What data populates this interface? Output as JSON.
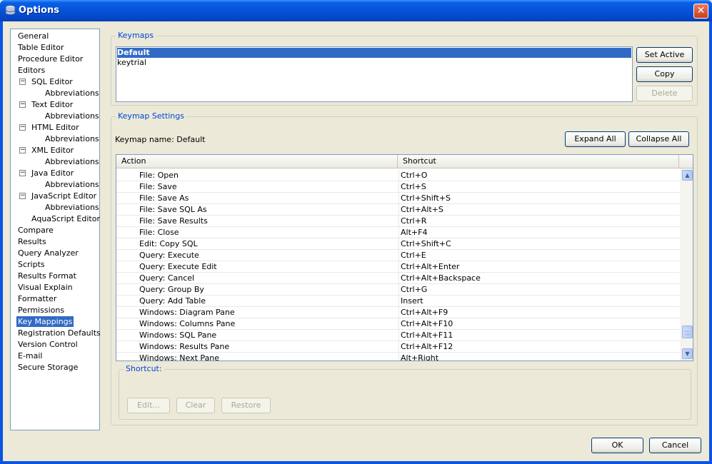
{
  "window": {
    "title": "Options",
    "close_glyph": "✕"
  },
  "nav": {
    "items": [
      {
        "label": "General",
        "indent": 0
      },
      {
        "label": "Table Editor",
        "indent": 0
      },
      {
        "label": "Procedure Editor",
        "indent": 0
      },
      {
        "label": "Editors",
        "indent": 0
      },
      {
        "label": "SQL Editor",
        "indent": 1,
        "expander": true
      },
      {
        "label": "Abbreviations",
        "indent": 2
      },
      {
        "label": "Text Editor",
        "indent": 1,
        "expander": true
      },
      {
        "label": "Abbreviations",
        "indent": 2
      },
      {
        "label": "HTML Editor",
        "indent": 1,
        "expander": true
      },
      {
        "label": "Abbreviations",
        "indent": 2
      },
      {
        "label": "XML Editor",
        "indent": 1,
        "expander": true
      },
      {
        "label": "Abbreviations",
        "indent": 2
      },
      {
        "label": "Java Editor",
        "indent": 1,
        "expander": true
      },
      {
        "label": "Abbreviations",
        "indent": 2
      },
      {
        "label": "JavaScript Editor",
        "indent": 1,
        "expander": true
      },
      {
        "label": "Abbreviations",
        "indent": 2
      },
      {
        "label": "AquaScript Editor",
        "indent": 1
      },
      {
        "label": "Compare",
        "indent": 0
      },
      {
        "label": "Results",
        "indent": 0
      },
      {
        "label": "Query Analyzer",
        "indent": 0
      },
      {
        "label": "Scripts",
        "indent": 0
      },
      {
        "label": "Results Format",
        "indent": 0
      },
      {
        "label": "Visual Explain",
        "indent": 0
      },
      {
        "label": "Formatter",
        "indent": 0
      },
      {
        "label": "Permissions",
        "indent": 0
      },
      {
        "label": "Key Mappings",
        "indent": 0,
        "selected": true
      },
      {
        "label": "Registration Defaults",
        "indent": 0
      },
      {
        "label": "Version Control",
        "indent": 0
      },
      {
        "label": "E-mail",
        "indent": 0
      },
      {
        "label": "Secure Storage",
        "indent": 0
      }
    ]
  },
  "keymaps": {
    "legend": "Keymaps",
    "list": [
      {
        "label": "Default",
        "selected": true
      },
      {
        "label": "keytrial"
      }
    ],
    "set_active": "Set Active",
    "copy": "Copy",
    "delete": "Delete"
  },
  "settings": {
    "legend": "Keymap Settings",
    "keymap_name_label": "Keymap name: Default",
    "expand_all": "Expand All",
    "collapse_all": "Collapse All",
    "columns": [
      "Action",
      "Shortcut"
    ],
    "rows": [
      {
        "action": "File: Open",
        "shortcut": "Ctrl+O"
      },
      {
        "action": "File: Save",
        "shortcut": "Ctrl+S"
      },
      {
        "action": "File: Save As",
        "shortcut": "Ctrl+Shift+S"
      },
      {
        "action": "File: Save SQL As",
        "shortcut": "Ctrl+Alt+S"
      },
      {
        "action": "File: Save Results",
        "shortcut": "Ctrl+R"
      },
      {
        "action": "File: Close",
        "shortcut": "Alt+F4"
      },
      {
        "action": "Edit: Copy SQL",
        "shortcut": "Ctrl+Shift+C"
      },
      {
        "action": "Query: Execute",
        "shortcut": "Ctrl+E"
      },
      {
        "action": "Query: Execute Edit",
        "shortcut": "Ctrl+Alt+Enter"
      },
      {
        "action": "Query: Cancel",
        "shortcut": "Ctrl+Alt+Backspace"
      },
      {
        "action": "Query: Group By",
        "shortcut": "Ctrl+G"
      },
      {
        "action": "Query: Add Table",
        "shortcut": "Insert"
      },
      {
        "action": "Windows: Diagram Pane",
        "shortcut": "Ctrl+Alt+F9"
      },
      {
        "action": "Windows: Columns Pane",
        "shortcut": "Ctrl+Alt+F10"
      },
      {
        "action": "Windows: SQL Pane",
        "shortcut": "Ctrl+Alt+F11"
      },
      {
        "action": "Windows: Results Pane",
        "shortcut": "Ctrl+Alt+F12"
      },
      {
        "action": "Windows: Next Pane",
        "shortcut": "Alt+Right"
      }
    ]
  },
  "shortcut": {
    "legend": "Shortcut:",
    "edit": "Edit...",
    "clear": "Clear",
    "restore": "Restore"
  },
  "footer": {
    "ok": "OK",
    "cancel": "Cancel"
  }
}
